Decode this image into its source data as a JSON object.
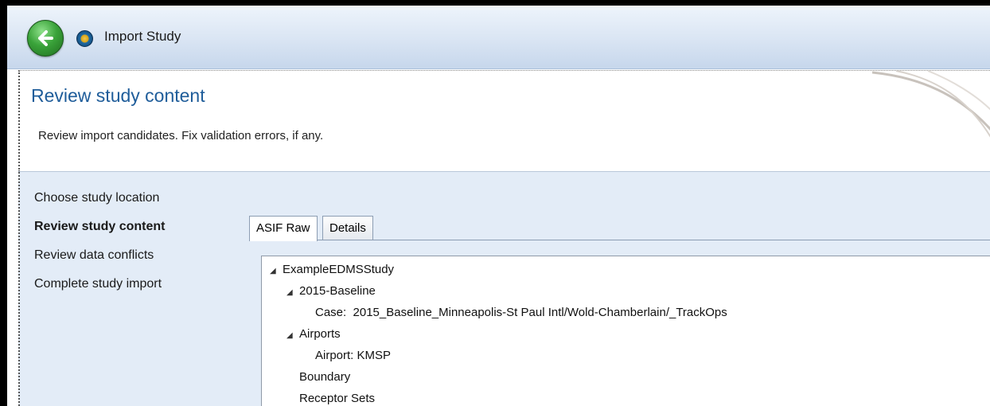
{
  "window": {
    "title": "Import Study"
  },
  "header": {
    "title": "Review study content",
    "subtitle": "Review import candidates. Fix validation errors, if any."
  },
  "nav": {
    "items": [
      {
        "label": "Choose study location",
        "active": false
      },
      {
        "label": "Review study content",
        "active": true
      },
      {
        "label": "Review data conflicts",
        "active": false
      },
      {
        "label": "Complete study import",
        "active": false
      }
    ]
  },
  "tabs": [
    {
      "label": "ASIF Raw",
      "active": true
    },
    {
      "label": "Details",
      "active": false
    }
  ],
  "tree": {
    "expander_glyph": "◢",
    "root": "ExampleEDMSStudy",
    "baseline": "2015-Baseline",
    "case_label": "Case:",
    "case_value": "2015_Baseline_Minneapolis-St Paul Intl/Wold-Chamberlain/_TrackOps",
    "airports": "Airports",
    "airport_label": "Airport:",
    "airport_value": "KMSP",
    "boundary": "Boundary",
    "receptor_sets": "Receptor Sets"
  },
  "icons": {
    "back": "back-arrow-icon",
    "app": "app-logo-icon"
  },
  "colors": {
    "title_blue": "#1f5d9a",
    "nav_bg": "#e3ecf7",
    "back_green": "#3aa33a"
  }
}
